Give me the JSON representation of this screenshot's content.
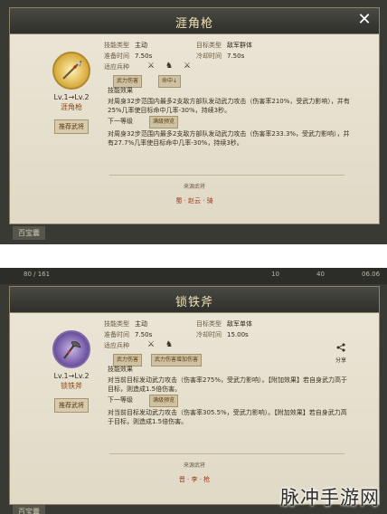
{
  "top": {
    "title": "涯角枪",
    "icon": "spear-icon",
    "level": "Lv.1→Lv.2",
    "name": "涯角枪",
    "recommend": "推荐武将",
    "skill_type_label": "技能类型",
    "skill_type": "主动",
    "target_type_label": "目标类型",
    "target_type": "敌军群体",
    "prep_label": "准备时间",
    "prep": "7.50s",
    "cooldown_label": "冷却时间",
    "cooldown": "7.50s",
    "units_label": "适应兵种",
    "tags": [
      "武力伤害",
      "命中↓"
    ],
    "effect_label": "技能效果",
    "effect_1": "对周身32步范围内最多2支敌方部队发动武力攻击（伤害率210%，受武力影响），并有25%几率使目标命中几率-30%，持续3秒。",
    "next_label": "下一等级",
    "next_tag": "满级预览",
    "effect_2": "对周身32步范围内最多2支敌方部队发动武力攻击（伤害率233.3%，受武力影响），并有27.7%几率使目标命中几率-30%，持续3秒。",
    "source_label": "来源武将",
    "source": "蜀 · 赵云 · 骑",
    "tab_stub": "百宝囊"
  },
  "bottom": {
    "hud": [
      "80 / 161",
      "10",
      "40",
      "06.06"
    ],
    "title": "锁铁斧",
    "icon": "axe-icon",
    "level": "Lv.1→Lv.2",
    "name": "锁铁斧",
    "recommend": "推荐武将",
    "skill_type_label": "技能类型",
    "skill_type": "主动",
    "target_type_label": "目标类型",
    "target_type": "敌军单体",
    "prep_label": "准备时间",
    "prep": "7.50s",
    "cooldown_label": "冷却时间",
    "cooldown": "15.00s",
    "units_label": "适应兵种",
    "tags": [
      "武力伤害",
      "武力伤害增加伤害"
    ],
    "effect_label": "技能效果",
    "effect_1": "对当前目标发动武力攻击（伤害率275%，受武力影响）。【附加效果】若自身武力高于目标，则造成1.5倍伤害。",
    "next_label": "下一等级",
    "next_tag": "满级预览",
    "effect_2": "对当前目标发动武力攻击（伤害率305.5%，受武力影响）。【附加效果】若自身武力高于目标，则造成1.5倍伤害。",
    "share": "分享",
    "source_label": "来源武将",
    "source": "晋 · 李 · 枪",
    "tab_stub": "百宝囊"
  },
  "watermark": "脉冲手游网"
}
